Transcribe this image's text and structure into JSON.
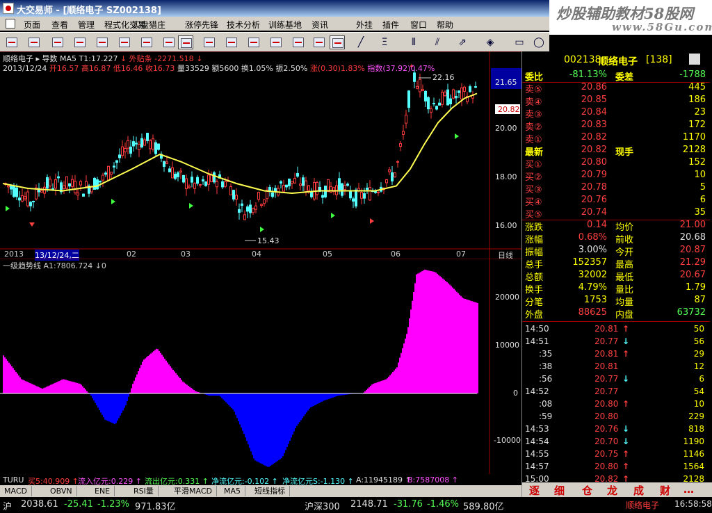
{
  "window": {
    "title": "大交易师 - [顺络电子  SZ002138]"
  },
  "watermark": {
    "line1": "炒股辅助教材58股网",
    "line2": "www.58Gu.com"
  },
  "menu": [
    "页面",
    "查看",
    "管理",
    "程式化交易",
    "实盘猎庄",
    "涨停先锋",
    "技术分析",
    "训练基地",
    "资讯",
    "外挂",
    "插件",
    "窗口",
    "帮助"
  ],
  "price_header": {
    "line1_a": "顺络电子",
    "line1_b": "▸ 导数 MA5 T1:17.227",
    "line1_c": "↓ 外贴条 -2271.518 ↓",
    "date": "2013/12/24",
    "open": "开16.57",
    "high": "高16.87",
    "low": "低16.46",
    "close": "收16.73",
    "vol": "量33529",
    "amt": "额5600",
    "turn": "换1.05%",
    "amp": "振2.50%",
    "chg": "涨(0.30)1.83%",
    "index": "指数(37.92)0.47%"
  },
  "price_axis": [
    "21.65",
    "20.00",
    "18.00",
    "16.00"
  ],
  "price_tag": "20.82",
  "hi_label": "22.16",
  "lo_label": "15.43",
  "time_axis": [
    "2013",
    "13/12/24,二",
    "02",
    "03",
    "04",
    "05",
    "06",
    "07",
    "日线"
  ],
  "sub_header": "一级趋势线  A1:7806.724 ↓0",
  "sub_axis": [
    "20000",
    "10000",
    "0",
    "-10000"
  ],
  "legend": {
    "l0": "TURU",
    "l1": "买5:40.909 ↑",
    "l2": "流入亿元:0.229 ↑",
    "l3": "流出亿元:0.331 ↑",
    "l4": "净流亿元:-0.102 ↑",
    "l5": "净流亿元S:-1.130 ↑",
    "l6": "A:11945189 ↑",
    "l7": "B:7587008 ↑"
  },
  "tabs": [
    "MACD",
    "OBVN",
    "ENE",
    "RSI量",
    "平滑MACD",
    "MA5",
    "短线指标"
  ],
  "status": {
    "sh": "沪",
    "sh_val": "2038.61",
    "sh_chg": "-25.41",
    "sh_pct": "-1.23%",
    "sh_amt": "971.83亿",
    "hs": "沪深300",
    "hs_val": "2148.71",
    "hs_chg": "-31.76",
    "hs_pct": "-1.46%",
    "hs_amt": "589.80亿",
    "stock": "顺络电子",
    "time": "16:58:58"
  },
  "quote": {
    "code": "002138",
    "name": "顺络电子",
    "suffix": "[138]",
    "wb": {
      "label": "委比",
      "val": "-81.13%",
      "label2": "委差",
      "val2": "-1788"
    },
    "sells": [
      {
        "l": "卖⑤",
        "p": "20.86",
        "v": "445"
      },
      {
        "l": "卖④",
        "p": "20.85",
        "v": "186"
      },
      {
        "l": "卖③",
        "p": "20.84",
        "v": "23"
      },
      {
        "l": "卖②",
        "p": "20.83",
        "v": "172"
      },
      {
        "l": "卖①",
        "p": "20.82",
        "v": "1170"
      }
    ],
    "latest": {
      "l": "最新",
      "p": "20.82",
      "l2": "现手",
      "v": "2128"
    },
    "buys": [
      {
        "l": "买①",
        "p": "20.80",
        "v": "152"
      },
      {
        "l": "买②",
        "p": "20.79",
        "v": "10"
      },
      {
        "l": "买③",
        "p": "20.78",
        "v": "5"
      },
      {
        "l": "买④",
        "p": "20.76",
        "v": "6"
      },
      {
        "l": "买⑤",
        "p": "20.74",
        "v": "35"
      }
    ],
    "stats": [
      {
        "l": "涨跌",
        "v": "0.14",
        "l2": "均价",
        "v2": "21.00"
      },
      {
        "l": "涨幅",
        "v": "0.68%",
        "l2": "前收",
        "v2": "20.68"
      },
      {
        "l": "振幅",
        "v": "3.00%",
        "l2": "今开",
        "v2": "20.87"
      },
      {
        "l": "总手",
        "v": "152357",
        "l2": "最高",
        "v2": "21.29"
      },
      {
        "l": "总额",
        "v": "32002",
        "l2": "最低",
        "v2": "20.67"
      },
      {
        "l": "换手",
        "v": "4.79%",
        "l2": "量比",
        "v2": "1.79"
      },
      {
        "l": "分笔",
        "v": "1753",
        "l2": "均量",
        "v2": "87"
      },
      {
        "l": "外盘",
        "v": "88625",
        "l2": "内盘",
        "v2": "63732"
      }
    ],
    "ticks": [
      {
        "t": "14:50",
        "p": "20.81",
        "d": "up",
        "v": "50"
      },
      {
        "t": "14:51",
        "p": "20.77",
        "d": "down",
        "v": "56"
      },
      {
        "t": ":35",
        "p": "20.81",
        "d": "up",
        "v": "29"
      },
      {
        "t": ":38",
        "p": "20.81",
        "d": "",
        "v": "12"
      },
      {
        "t": ":56",
        "p": "20.77",
        "d": "down",
        "v": "6"
      },
      {
        "t": "14:52",
        "p": "20.77",
        "d": "",
        "v": "54"
      },
      {
        "t": ":08",
        "p": "20.80",
        "d": "up",
        "v": "10"
      },
      {
        "t": ":59",
        "p": "20.80",
        "d": "",
        "v": "229"
      },
      {
        "t": "14:53",
        "p": "20.76",
        "d": "down",
        "v": "818"
      },
      {
        "t": "14:54",
        "p": "20.70",
        "d": "down",
        "v": "1190"
      },
      {
        "t": "14:55",
        "p": "20.75",
        "d": "up",
        "v": "1146"
      },
      {
        "t": "14:57",
        "p": "20.80",
        "d": "up",
        "v": "1564"
      },
      {
        "t": "15:00",
        "p": "20.82",
        "d": "up",
        "v": "2128"
      }
    ],
    "tabs": [
      "逐",
      "细",
      "仓",
      "龙",
      "成",
      "财",
      "…"
    ]
  }
}
